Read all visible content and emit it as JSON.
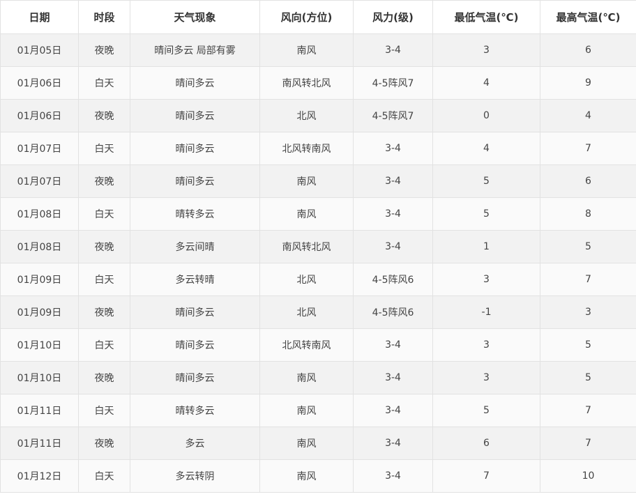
{
  "table": {
    "headers": [
      "日期",
      "时段",
      "天气现象",
      "风向(方位)",
      "风力(级)",
      "最低气温(℃)",
      "最高气温(℃)"
    ],
    "rows": [
      [
        "01月05日",
        "夜晚",
        "晴间多云 局部有雾",
        "南风",
        "3-4",
        "3",
        "6"
      ],
      [
        "01月06日",
        "白天",
        "晴间多云",
        "南风转北风",
        "4-5阵风7",
        "4",
        "9"
      ],
      [
        "01月06日",
        "夜晚",
        "晴间多云",
        "北风",
        "4-5阵风7",
        "0",
        "4"
      ],
      [
        "01月07日",
        "白天",
        "晴间多云",
        "北风转南风",
        "3-4",
        "4",
        "7"
      ],
      [
        "01月07日",
        "夜晚",
        "晴间多云",
        "南风",
        "3-4",
        "5",
        "6"
      ],
      [
        "01月08日",
        "白天",
        "晴转多云",
        "南风",
        "3-4",
        "5",
        "8"
      ],
      [
        "01月08日",
        "夜晚",
        "多云间晴",
        "南风转北风",
        "3-4",
        "1",
        "5"
      ],
      [
        "01月09日",
        "白天",
        "多云转晴",
        "北风",
        "4-5阵风6",
        "3",
        "7"
      ],
      [
        "01月09日",
        "夜晚",
        "晴间多云",
        "北风",
        "4-5阵风6",
        "-1",
        "3"
      ],
      [
        "01月10日",
        "白天",
        "晴间多云",
        "北风转南风",
        "3-4",
        "3",
        "5"
      ],
      [
        "01月10日",
        "夜晚",
        "晴间多云",
        "南风",
        "3-4",
        "3",
        "5"
      ],
      [
        "01月11日",
        "白天",
        "晴转多云",
        "南风",
        "3-4",
        "5",
        "7"
      ],
      [
        "01月11日",
        "夜晚",
        "多云",
        "南风",
        "3-4",
        "6",
        "7"
      ],
      [
        "01月12日",
        "白天",
        "多云转阴",
        "南风",
        "3-4",
        "7",
        "10"
      ]
    ]
  }
}
